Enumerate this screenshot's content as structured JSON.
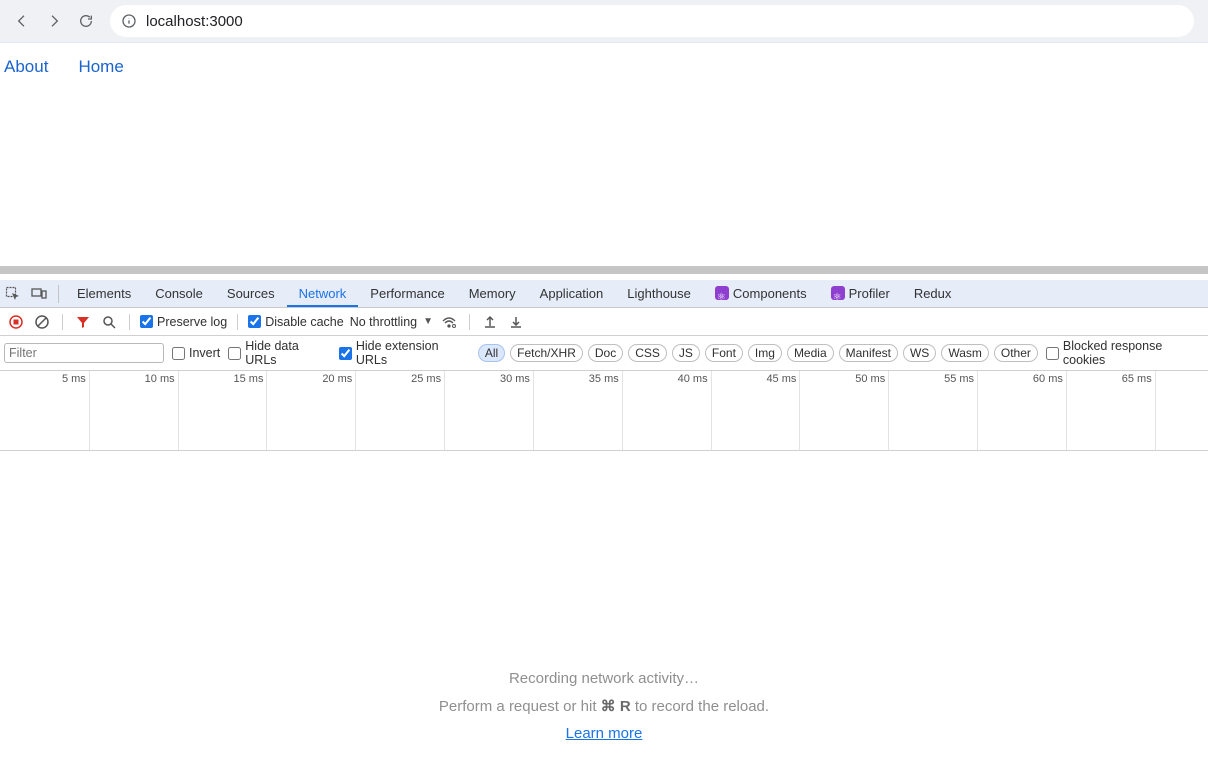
{
  "browser": {
    "url": "localhost:3000"
  },
  "page": {
    "links": [
      "About",
      "Home"
    ]
  },
  "devtools": {
    "tabs": [
      "Elements",
      "Console",
      "Sources",
      "Network",
      "Performance",
      "Memory",
      "Application",
      "Lighthouse"
    ],
    "ext_tabs": [
      "Components",
      "Profiler",
      "Redux"
    ],
    "active_tab": "Network"
  },
  "network_toolbar": {
    "preserve_log": "Preserve log",
    "disable_cache": "Disable cache",
    "throttling": "No throttling"
  },
  "filter_bar": {
    "placeholder": "Filter",
    "invert": "Invert",
    "hide_data": "Hide data URLs",
    "hide_ext": "Hide extension URLs",
    "chips": [
      "All",
      "Fetch/XHR",
      "Doc",
      "CSS",
      "JS",
      "Font",
      "Img",
      "Media",
      "Manifest",
      "WS",
      "Wasm",
      "Other"
    ],
    "chip_active": "All",
    "blocked_cookies": "Blocked response cookies"
  },
  "timeline": {
    "ticks": [
      "5 ms",
      "10 ms",
      "15 ms",
      "20 ms",
      "25 ms",
      "30 ms",
      "35 ms",
      "40 ms",
      "45 ms",
      "50 ms",
      "55 ms",
      "60 ms",
      "65 ms"
    ]
  },
  "empty_state": {
    "line1": "Recording network activity…",
    "line2_prefix": "Perform a request or hit ",
    "line2_shortcut": "⌘ R",
    "line2_suffix": " to record the reload.",
    "learn_more": "Learn more"
  }
}
